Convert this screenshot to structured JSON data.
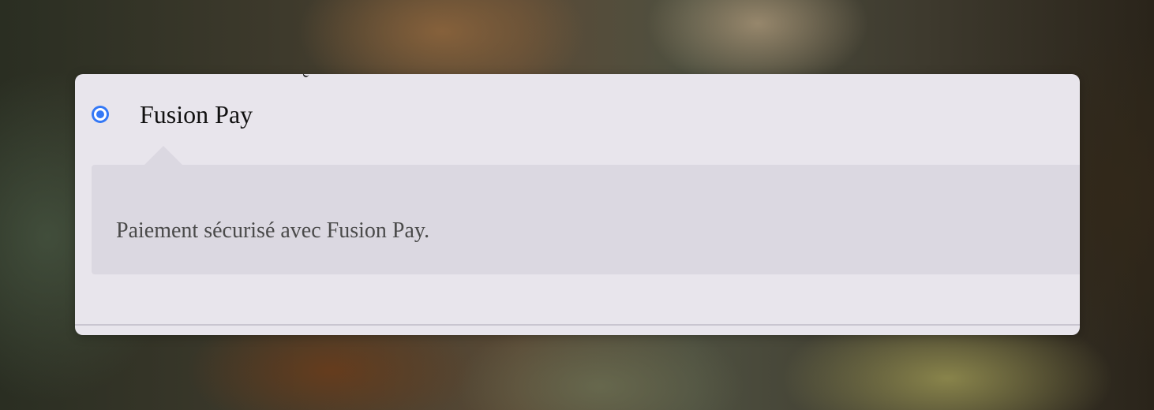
{
  "payment": {
    "selected_method": "Fusion Pay",
    "option_label": "Fusion Pay",
    "description": "Paiement sécurisé avec Fusion Pay.",
    "accent_color": "#3478f6"
  }
}
